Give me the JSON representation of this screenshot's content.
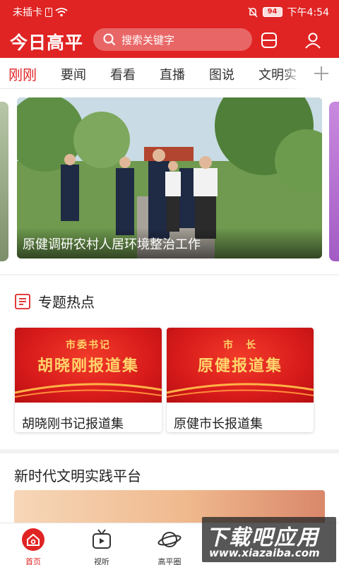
{
  "status_bar": {
    "carrier": "未插卡",
    "battery": "94",
    "time": "下午4:54"
  },
  "header": {
    "title": "今日高平",
    "search_placeholder": "搜索关键字"
  },
  "tabs": [
    "刚刚",
    "要闻",
    "看看",
    "直播",
    "图说",
    "文明实"
  ],
  "carousel": {
    "caption": "原健调研农村人居环境整治工作"
  },
  "topics": {
    "title": "专题热点",
    "cards": [
      {
        "banner_sub": "市委书记",
        "banner_main": "胡晓刚报道集",
        "label": "胡晓刚书记报道集"
      },
      {
        "banner_sub": "市　长",
        "banner_main": "原健报道集",
        "label": "原健市长报道集"
      }
    ]
  },
  "civilization": {
    "title": "新时代文明实践平台"
  },
  "bottom_nav": [
    "首页",
    "视听",
    "高平圈"
  ],
  "watermark": {
    "main": "下载吧应用",
    "sub": "www.xiazaiba.com"
  },
  "colors": {
    "brand_red": "#e02424",
    "banner_gold": "#ffd36a"
  }
}
